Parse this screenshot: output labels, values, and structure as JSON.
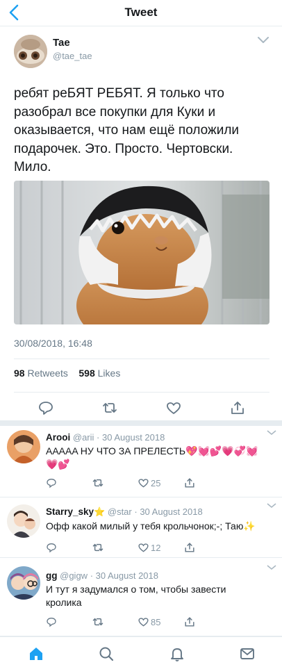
{
  "nav": {
    "title": "Tweet"
  },
  "tweet": {
    "author_name": "Tae",
    "author_handle": "@tae_tae",
    "text": "ребят реБЯТ РЕБЯТ. Я только что разобрал все покупки для Куки и оказывается, что нам ещё положили подарочек. Это. Просто. Чертовски. Мило.",
    "timestamp": "30/08/2018, 16:48",
    "retweets_count": "98",
    "retweets_label": "Retweets",
    "likes_count": "598",
    "likes_label": "Likes"
  },
  "replies": [
    {
      "name": "Arooi",
      "badge": "",
      "handle": "@arii",
      "date": "· 30 August 2018",
      "text": "АААAA НУ ЧТО ЗА ПРЕЛЕСТЬ💖💓💕💗💞💓💗💕",
      "likes": "25"
    },
    {
      "name": "Starry_sky",
      "badge": "⭐",
      "handle": "@star",
      "date": "· 30 August 2018",
      "text": "Офф какой милый у тебя крольчонок;-; Таю✨",
      "likes": "12"
    },
    {
      "name": "gg",
      "badge": "",
      "handle": "@gigw",
      "date": "· 30 August 2018",
      "text": "И тут я задумался о том, чтобы завести кролика",
      "likes": "85"
    }
  ],
  "colors": {
    "accent": "#1da1f2",
    "secondary_text": "#657786",
    "muted_icon": "#8899a6",
    "separator": "#e6ecf0"
  },
  "icons": [
    "back-chevron-icon",
    "caret-down-icon",
    "reply-icon",
    "retweet-icon",
    "like-icon",
    "share-icon",
    "home-icon",
    "search-icon",
    "notifications-icon",
    "messages-icon"
  ]
}
